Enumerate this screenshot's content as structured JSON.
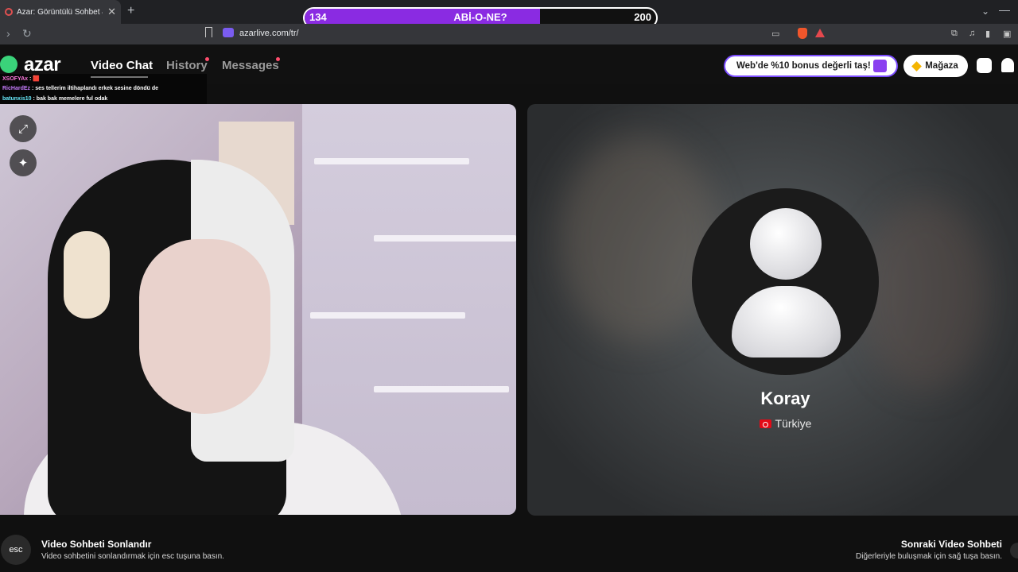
{
  "browser": {
    "tab_title": "Azar: Görüntülü Sohbet & Ye",
    "url": "azarlive.com/tr/",
    "new_tab": "+",
    "tab_close": "✕"
  },
  "progress": {
    "left_value": "134",
    "center_text": "ABİ-O-NE?",
    "right_value": "200",
    "fill_fraction": 0.67,
    "fill_color": "#8a2be2"
  },
  "header": {
    "logo": "azar",
    "nav": [
      {
        "label": "Video Chat",
        "active": true,
        "has_dot": false
      },
      {
        "label": "History",
        "active": false,
        "has_dot": true
      },
      {
        "label": "Messages",
        "active": false,
        "has_dot": true
      }
    ],
    "promo_text": "Web'de %10 bonus değerli taş!",
    "shop_label": "Mağaza"
  },
  "chat": [
    {
      "user": "XSOFYAx",
      "text": " : 🟥",
      "color": "#ff7adf"
    },
    {
      "user": "RicHardEz",
      "text": " : ses tellerim iltihaplandı erkek sesine döndü de",
      "color": "#c77dff"
    },
    {
      "user": "batunxis10",
      "text": " : bak bak memelere ful odak",
      "color": "#67e8f9"
    }
  ],
  "peer": {
    "name": "Koray",
    "country": "Türkiye"
  },
  "hints": {
    "esc_key": "esc",
    "end_title": "Video Sohbeti Sonlandır",
    "end_sub": "Video sohbetini sonlandırmak için esc tuşuna basın.",
    "next_title": "Sonraki Video Sohbeti",
    "next_sub": "Diğerleriyle buluşmak için sağ tuşa basın."
  },
  "colors": {
    "accent": "#7c4dff",
    "notification_dot": "#ff4d6d"
  }
}
